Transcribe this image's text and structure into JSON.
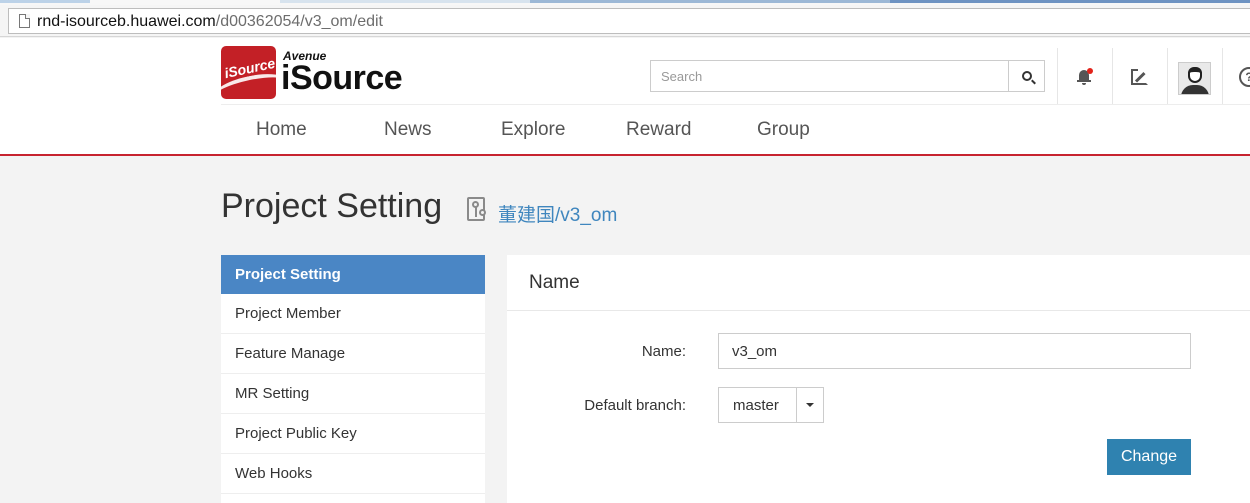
{
  "browser": {
    "url_host": "rnd-isourceb.huawei.com",
    "url_path": "/d00362054/v3_om/edit"
  },
  "header": {
    "logo_badge_text": "iSource",
    "logo_tagline": "Avenue",
    "logo_name": "iSource",
    "search_placeholder": "Search",
    "nav": [
      "Home",
      "News",
      "Explore",
      "Reward",
      "Group"
    ],
    "help_glyph": "?"
  },
  "page": {
    "title": "Project Setting",
    "repo_link": "董建国/v3_om"
  },
  "sidebar": {
    "items": [
      {
        "label": "Project Setting",
        "active": true
      },
      {
        "label": "Project Member",
        "active": false
      },
      {
        "label": "Feature Manage",
        "active": false
      },
      {
        "label": "MR Setting",
        "active": false
      },
      {
        "label": "Project Public Key",
        "active": false
      },
      {
        "label": "Web Hooks",
        "active": false
      }
    ]
  },
  "panel": {
    "title": "Name",
    "name_label": "Name:",
    "name_value": "v3_om",
    "branch_label": "Default branch:",
    "branch_value": "master",
    "change_label": "Change"
  },
  "colors": {
    "brand_red": "#c32026",
    "active_blue": "#4a86c5",
    "button_blue": "#2f82b0",
    "link_blue": "#3f86be"
  }
}
